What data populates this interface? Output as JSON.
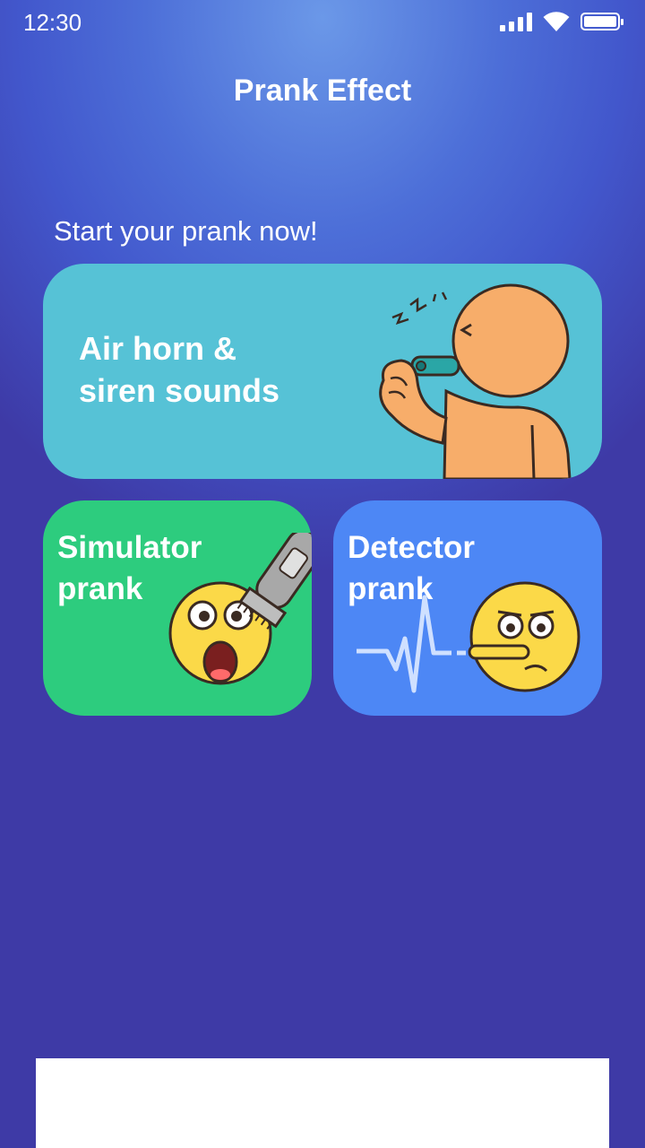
{
  "status_bar": {
    "time": "12:30"
  },
  "header": {
    "title": "Prank Effect"
  },
  "main": {
    "subtitle": "Start your prank now!",
    "cards": [
      {
        "label": "Air horn &\nsiren sounds",
        "color": "#56c2d6",
        "illustration": "whistle-character-icon"
      },
      {
        "label": "Simulator\nprank",
        "color": "#2dcc7e",
        "illustration": "hair-clipper-shocked-emoji-icon"
      },
      {
        "label": "Detector\nprank",
        "color": "#4d87f5",
        "illustration": "heartbeat-lying-emoji-icon"
      }
    ]
  },
  "colors": {
    "bg_top": "#6b98e8",
    "bg_bottom": "#3e3aa6",
    "skin": "#f7ad6a",
    "emoji": "#fbd948"
  }
}
